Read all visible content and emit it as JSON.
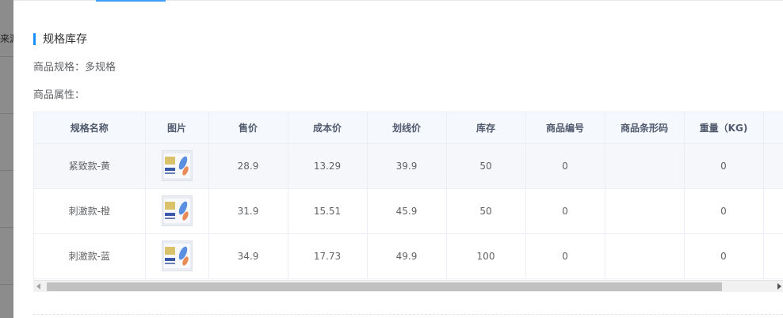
{
  "backdrop": {
    "fragment_text": "来源"
  },
  "section": {
    "title": "规格库存"
  },
  "spec": {
    "label": "商品规格：",
    "value": "多规格"
  },
  "attributes": {
    "label": "商品属性："
  },
  "table": {
    "headers": [
      "规格名称",
      "图片",
      "售价",
      "成本价",
      "划线价",
      "库存",
      "商品编号",
      "商品条形码",
      "重量（KG)",
      ""
    ],
    "rows": [
      {
        "name": "紧致款-黄",
        "price": "28.9",
        "cost": "13.29",
        "list_price": "39.9",
        "stock": "50",
        "code": "0",
        "barcode": "",
        "weight": "0",
        "extra": ""
      },
      {
        "name": "刺激款-橙",
        "price": "31.9",
        "cost": "15.51",
        "list_price": "45.9",
        "stock": "50",
        "code": "0",
        "barcode": "",
        "weight": "0",
        "extra": ""
      },
      {
        "name": "刺激款-蓝",
        "price": "34.9",
        "cost": "17.73",
        "list_price": "49.9",
        "stock": "100",
        "code": "0",
        "barcode": "",
        "weight": "0",
        "extra": ""
      }
    ]
  },
  "icons": {
    "product_image": "product-thumbnail-icon",
    "scroll_left": "chevron-left-icon",
    "scroll_right": "chevron-right-icon"
  },
  "colors": {
    "accent": "#1890ff",
    "header_bg": "#f5f8fd",
    "hover_row_bg": "#f5f7fa"
  }
}
